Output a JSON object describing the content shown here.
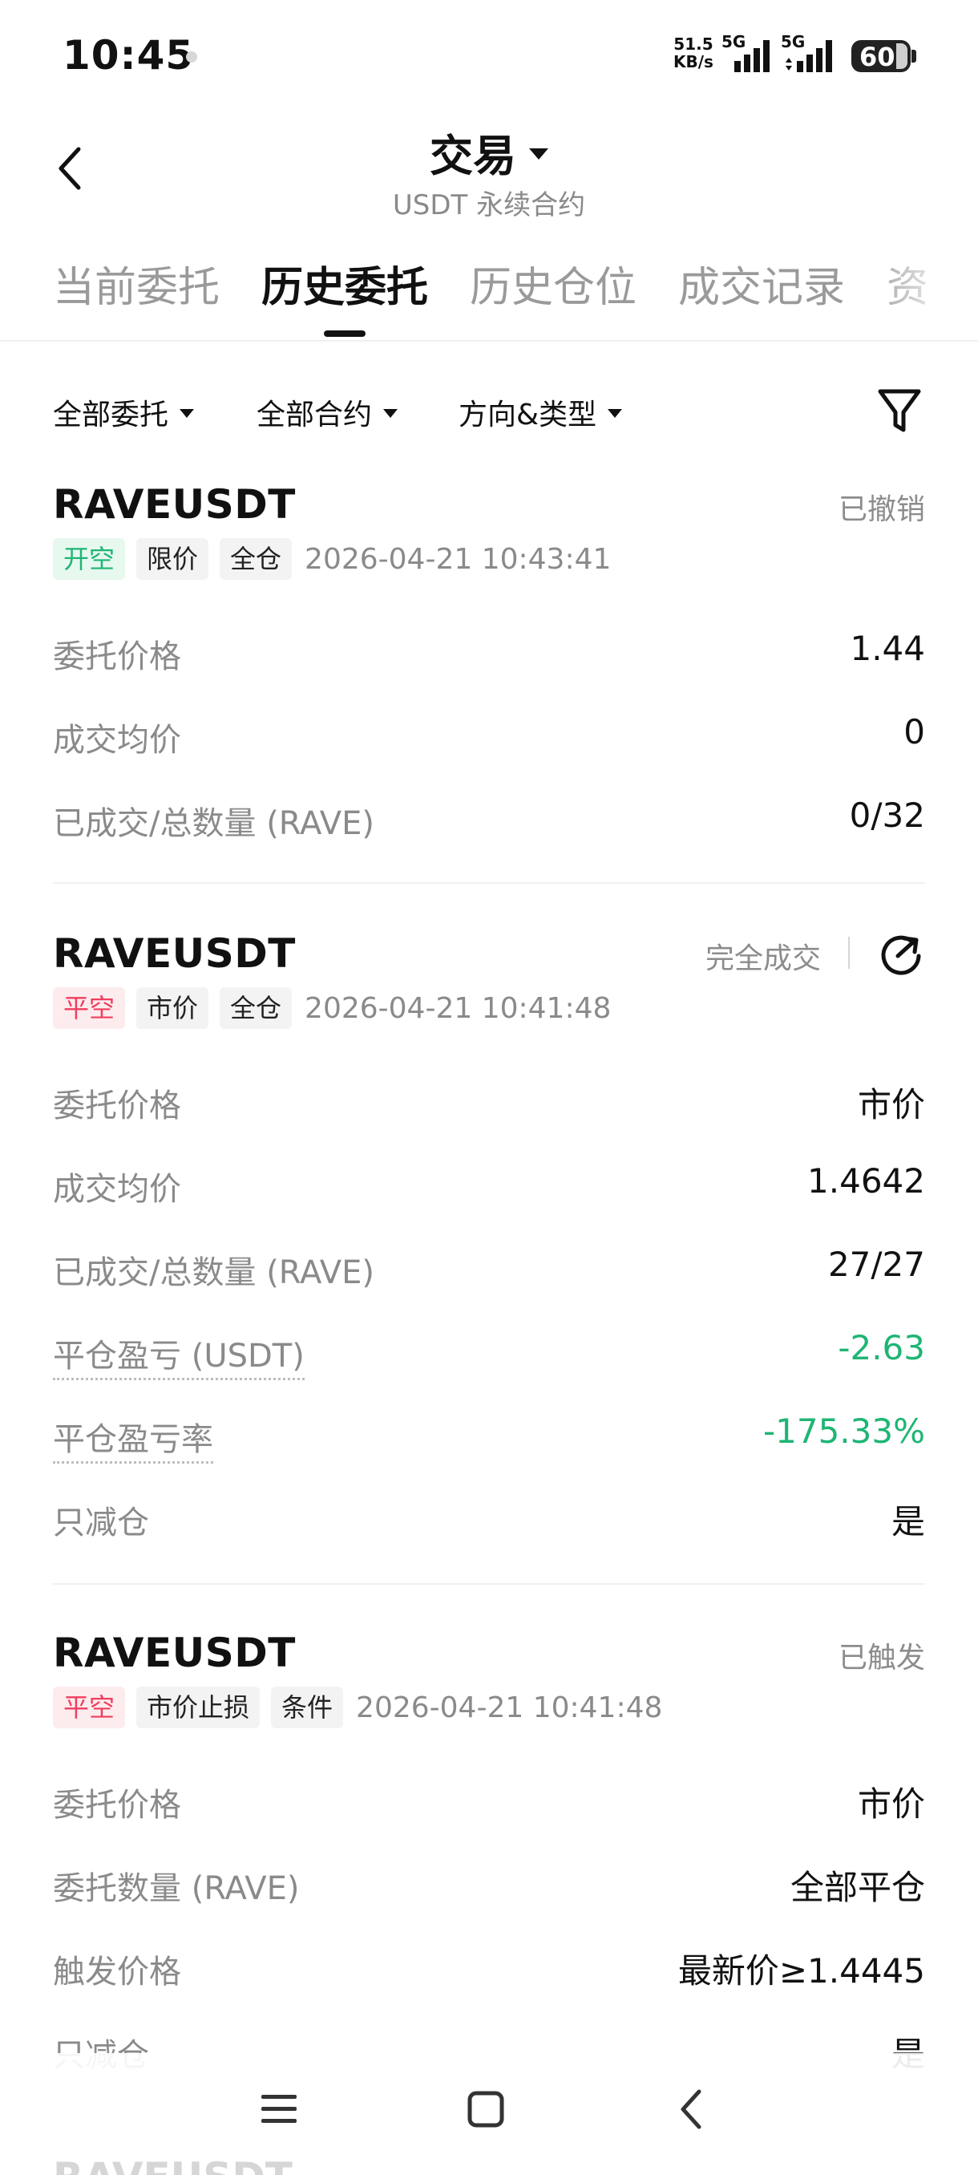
{
  "status_bar": {
    "time": "10:45",
    "net_speed_value": "51.5",
    "net_speed_unit": "KB/s",
    "sim1_label": "5G",
    "sim2_label": "5G",
    "battery": "60"
  },
  "header": {
    "title": "交易",
    "subtitle": "USDT 永续合约"
  },
  "tabs": [
    {
      "label": "当前委托",
      "active": false
    },
    {
      "label": "历史委托",
      "active": true
    },
    {
      "label": "历史仓位",
      "active": false
    },
    {
      "label": "成交记录",
      "active": false
    },
    {
      "label": "资",
      "active": false
    }
  ],
  "filters": {
    "order_type": "全部委托",
    "contract": "全部合约",
    "direction_type": "方向&类型"
  },
  "orders": [
    {
      "symbol": "RAVEUSDT",
      "status": "已撤销",
      "tags": [
        "开空",
        "限价",
        "全仓"
      ],
      "time": "2026-04-21 10:43:41",
      "rows": [
        {
          "label": "委托价格",
          "value": "1.44"
        },
        {
          "label": "成交均价",
          "value": "0"
        },
        {
          "label": "已成交/总数量 (RAVE)",
          "value": "0/32"
        }
      ]
    },
    {
      "symbol": "RAVEUSDT",
      "status": "完全成交",
      "tags": [
        "平空",
        "市价",
        "全仓"
      ],
      "time": "2026-04-21 10:41:48",
      "rows": [
        {
          "label": "委托价格",
          "value": "市价"
        },
        {
          "label": "成交均价",
          "value": "1.4642"
        },
        {
          "label": "已成交/总数量 (RAVE)",
          "value": "27/27"
        },
        {
          "label": "平仓盈亏 (USDT)",
          "value": "-2.63"
        },
        {
          "label": "平仓盈亏率",
          "value": "-175.33%"
        },
        {
          "label": "只减仓",
          "value": "是"
        }
      ]
    },
    {
      "symbol": "RAVEUSDT",
      "status": "已触发",
      "tags": [
        "平空",
        "市价止损",
        "条件"
      ],
      "time": "2026-04-21 10:41:48",
      "rows": [
        {
          "label": "委托价格",
          "value": "市价"
        },
        {
          "label": "委托数量 (RAVE)",
          "value": "全部平仓"
        },
        {
          "label": "触发价格",
          "value": "最新价≥1.4445"
        },
        {
          "label": "只减仓",
          "value": "是"
        }
      ]
    }
  ],
  "peek_symbol": "RAVEUSDT",
  "colors": {
    "profit_green": "#1fb574",
    "loss_red": "#ef3e5e",
    "muted_text": "#8a8a8a"
  },
  "icons": {
    "back": "chevron-left-icon",
    "filter": "filter-funnel-icon",
    "reorder": "refresh-arrow-icon",
    "nav_menu": "menu-lines-icon",
    "nav_home": "square-home-icon",
    "nav_back": "chevron-left-icon"
  }
}
